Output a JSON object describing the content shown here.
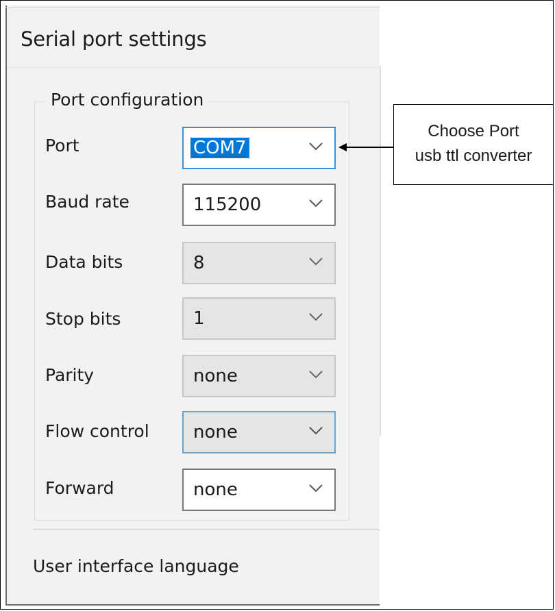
{
  "window": {
    "title": "Serial port settings"
  },
  "port_configuration": {
    "legend": "Port configuration",
    "fields": [
      {
        "label": "Port",
        "value": "COM7"
      },
      {
        "label": "Baud rate",
        "value": "115200"
      },
      {
        "label": "Data bits",
        "value": "8"
      },
      {
        "label": "Stop bits",
        "value": "1"
      },
      {
        "label": "Parity",
        "value": "none"
      },
      {
        "label": "Flow control",
        "value": "none"
      },
      {
        "label": "Forward",
        "value": "none"
      }
    ]
  },
  "footer": {
    "language_label": "User interface language"
  },
  "annotation": {
    "line1": "Choose Port",
    "line2": "usb ttl converter"
  },
  "icons": {
    "dropdown": "chevron-down-icon",
    "arrow": "arrow-left-icon"
  },
  "colors": {
    "selection": "#0078d7",
    "focus_border": "#3e8ed4",
    "window_bg": "#f2f2f2"
  }
}
